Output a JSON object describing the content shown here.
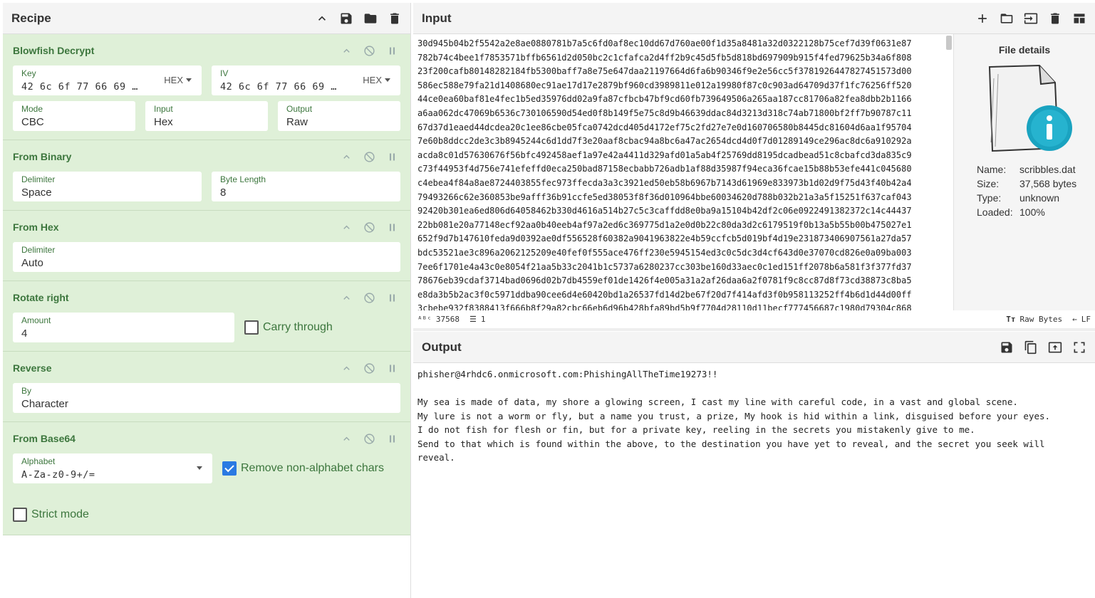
{
  "recipe": {
    "title": "Recipe",
    "operations": [
      {
        "title": "Blowfish Decrypt",
        "key": {
          "label": "Key",
          "value": "42 6c 6f 77 66 69 …",
          "format": "HEX"
        },
        "iv": {
          "label": "IV",
          "value": "42 6c 6f 77 66 69 …",
          "format": "HEX"
        },
        "mode": {
          "label": "Mode",
          "value": "CBC"
        },
        "input": {
          "label": "Input",
          "value": "Hex"
        },
        "output": {
          "label": "Output",
          "value": "Raw"
        }
      },
      {
        "title": "From Binary",
        "delimiter": {
          "label": "Delimiter",
          "value": "Space"
        },
        "byte_length": {
          "label": "Byte Length",
          "value": "8"
        }
      },
      {
        "title": "From Hex",
        "delimiter": {
          "label": "Delimiter",
          "value": "Auto"
        }
      },
      {
        "title": "Rotate right",
        "amount": {
          "label": "Amount",
          "value": "4"
        },
        "carry_label": "Carry through",
        "carry_checked": false
      },
      {
        "title": "Reverse",
        "by": {
          "label": "By",
          "value": "Character"
        }
      },
      {
        "title": "From Base64",
        "alphabet": {
          "label": "Alphabet",
          "value": "A-Za-z0-9+/="
        },
        "remove_label": "Remove non-alphabet chars",
        "remove_checked": true,
        "strict_label": "Strict mode",
        "strict_checked": false
      }
    ]
  },
  "input": {
    "title": "Input",
    "lines": [
      "30d945b04b2f5542a2e8ae0880781b7a5c6fd0af8ec10dd67d760ae00f1d35a8481a32d0322128b75cef7d39f0631e87",
      "782b74c4bee1f7853571bffb6561d2d050bc2c1cfafca2d4ff2b9c45d5fb5d818bd697909b915f4fed79625b34a6f808",
      "23f200cafb80148282184fb5300baff7a8e75e647daa21197664d6fa6b90346f9e2e56cc5f3781926447827451573d00",
      "586ec588e79fa21d1408680ec91ae17d17e2879bf960cd3989811e012a19980f87c0c903ad64709d37f1fc76256ff520",
      "44ce0ea60baf81e4fec1b5ed35976dd02a9fa87cfbcb47bf9cd60fb739649506a265aa187cc81706a82fea8dbb2b1166",
      "a6aa062dc47069b6536c730106590d54ed0f8b149f5e75c8d9b46639ddac84d3213d318c74ab71800bf2ff7b90787c11",
      "67d37d1eaed44dcdea20c1ee86cbe05fca0742dcd405d4172ef75c2fd27e7e0d160706580b8445dc81604d6aa1f95704",
      "7e60b8ddcc2de3c3b8945244c6d1dd7f3e20aaf8cbac94a8bc6a47ac2654dcd4d0f7d01289149ce296ac8dc6a910292a",
      "acda8c01d57630676f56bfc492458aef1a97e42a4411d329afd01a5ab4f25769dd8195dcadbead51c8cbafcd3da835c9",
      "c73f44953f4d756e741efeffd0eca250bad87158ecbabb726adb1af88d35987f94eca36fcae15b88b53efe441c045680",
      "c4ebea4f84a8ae8724403855fec973ffecda3a3c3921ed50eb58b6967b7143d61969e833973b1d02d9f75d43f40b42a4",
      "79493266c62e360853be9afff36b91ccfe5ed38053f8f36d010964bbe60034620d788b032b21a3a5f15251f637caf043",
      "92420b301ea6ed806d64058462b330d4616a514b27c5c3caffdd8e0ba9a15104b42df2c06e0922491382372c14c44437",
      "22bb081e20a77148ecf92aa0b40eeb4af97a2ed6c369775d1a2e0d0b22c80da3d2c6179519f0b13a5b55b00b475027e1",
      "652f9d7b147610feda9d0392ae0df556528f60382a9041963822e4b59ccfcb5d019bf4d19e231873406907561a27da57",
      "bdc53521ae3c896a2062125209e40fef0f555ace476ff230e5945154ed3c0c5dc3d4cf643d0e37070cd826e0a09ba003",
      "7ee6f1701e4a43c0e8054f21aa5b33c2041b1c5737a6280237cc303be160d33aec0c1ed151ff2078b6a581f3f377fd37",
      "78676eb39cdaf3714bad0696d02b7db4559ef01de1426f4e005a31a2af26daa6a2f0781f9c8cc87d8f73cd38873c8ba5",
      "e8da3b5b2ac3f0c5971ddba90cee6d4e60420bd1a26537fd14d2be67f20d7f414afd3f0b958113252ff4b6d1d44d00ff",
      "3cbebe932f8388413f666b8f29a82cbc66eb6d96b428bfa89bd5b9f7704d28110d11becf777456687c1980d79304c868"
    ],
    "file_details": {
      "title": "File details",
      "name_label": "Name:",
      "name": "scribbles.dat",
      "size_label": "Size:",
      "size": "37,568 bytes",
      "type_label": "Type:",
      "type": "unknown",
      "loaded_label": "Loaded:",
      "loaded": "100%"
    },
    "status": {
      "abc": "ᴬᴮᶜ",
      "length": "37568",
      "lines": "1",
      "encoding": "Raw Bytes",
      "eol": "LF"
    }
  },
  "output": {
    "title": "Output",
    "text": "phisher@4rhdc6.onmicrosoft.com:PhishingAllTheTime19273!!\n\nMy sea is made of data, my shore a glowing screen, I cast my line with careful code, in a vast and global scene.\nMy lure is not a worm or fly, but a name you trust, a prize, My hook is hid within a link, disguised before your eyes.\nI do not fish for flesh or fin, but for a private key, reeling in the secrets you mistakenly give to me.\nSend to that which is found within the above, to the destination you have yet to reveal, and the secret you seek will\nreveal."
  },
  "colors": {
    "op_background": "#dff0d8",
    "op_text": "#3c763d",
    "checkbox_on": "#2a7ae2"
  }
}
